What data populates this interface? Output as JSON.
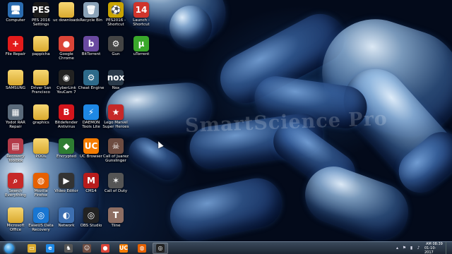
{
  "desktop": {
    "watermark": "SmartScience Pro",
    "icons": [
      {
        "label": "Computer",
        "icon": "computer-icon",
        "glyph": "🖥",
        "color": "#2b6cb0"
      },
      {
        "label": "PES 2016 Settings",
        "icon": "pes-settings-icon",
        "glyph": "PES",
        "color": "#1a1a1a"
      },
      {
        "label": "uc downloads",
        "icon": "folder-icon",
        "glyph": "",
        "color": "#d9a92e"
      },
      {
        "label": "Recycle Bin",
        "icon": "recycle-bin-icon",
        "glyph": "🗑",
        "color": "#8aa2b8"
      },
      {
        "label": "PES2016 - Shortcut",
        "icon": "pes-game-icon",
        "glyph": "⚽",
        "color": "#c9a400"
      },
      {
        "label": "Launch - Shortcut",
        "icon": "launch-icon",
        "glyph": "14",
        "color": "#d0342c"
      },
      {
        "label": "File Repair",
        "icon": "file-repair-icon",
        "glyph": "+",
        "color": "#e31b1b"
      },
      {
        "label": "pappicha",
        "icon": "folder-icon",
        "glyph": "",
        "color": "#d9a92e"
      },
      {
        "label": "Google Chrome",
        "icon": "chrome-icon",
        "glyph": "●",
        "color": "#db4437"
      },
      {
        "label": "BitTorrent",
        "icon": "bittorrent-icon",
        "glyph": "b",
        "color": "#6a4aa0"
      },
      {
        "label": "Gun",
        "icon": "gun-icon",
        "glyph": "⚙",
        "color": "#444"
      },
      {
        "label": "uTorrent",
        "icon": "utorrent-icon",
        "glyph": "µ",
        "color": "#3aa82b"
      },
      {
        "label": "SAMSUNG",
        "icon": "folder-icon",
        "glyph": "",
        "color": "#d9a92e"
      },
      {
        "label": "Driver San Francisco",
        "icon": "folder-icon",
        "glyph": "",
        "color": "#d9a92e"
      },
      {
        "label": "CyberLink YouCam 7",
        "icon": "youcam-icon",
        "glyph": "◉",
        "color": "#222"
      },
      {
        "label": "Cheat Engine",
        "icon": "cheat-engine-icon",
        "glyph": "⚙",
        "color": "#2d6a8a"
      },
      {
        "label": "Nox",
        "icon": "nox-icon",
        "glyph": "nox",
        "color": "#2a3a4a"
      },
      {
        "label": "Yodot RAR Repair",
        "icon": "yodot-icon",
        "glyph": "▦",
        "color": "#5a6a7a"
      },
      {
        "label": "graphics",
        "icon": "folder-icon",
        "glyph": "",
        "color": "#d9a92e"
      },
      {
        "label": "Bitdefender Antivirus",
        "icon": "bitdefender-icon",
        "glyph": "B",
        "color": "#d4151c"
      },
      {
        "label": "DAEMON Tools Lite",
        "icon": "daemon-tools-icon",
        "glyph": "⚡",
        "color": "#1e88e5"
      },
      {
        "label": "Lego Marvel Super Heroes",
        "icon": "lego-marvel-icon",
        "glyph": "★",
        "color": "#c62828"
      },
      {
        "label": "Recovery Toolbox",
        "icon": "recovery-toolbox-icon",
        "glyph": "▤",
        "color": "#b23a48"
      },
      {
        "label": "POOL",
        "icon": "folder-icon",
        "glyph": "",
        "color": "#d9a92e"
      },
      {
        "label": "Encrypted",
        "icon": "encrypted-icon",
        "glyph": "◆",
        "color": "#2e7d32"
      },
      {
        "label": "UC Browser",
        "icon": "uc-browser-icon",
        "glyph": "UC",
        "color": "#f57c00"
      },
      {
        "label": "Call of Juarez Gunslinger",
        "icon": "call-of-juarez-icon",
        "glyph": "☠",
        "color": "#6d4c41"
      },
      {
        "label": "Search Everything",
        "icon": "search-everything-icon",
        "glyph": "⌕",
        "color": "#c62828"
      },
      {
        "label": "Mozilla Firefox",
        "icon": "firefox-icon",
        "glyph": "◍",
        "color": "#e66000"
      },
      {
        "label": "Video Editor",
        "icon": "video-editor-icon",
        "glyph": "▶",
        "color": "#333"
      },
      {
        "label": "CM14",
        "icon": "cm14-icon",
        "glyph": "M",
        "color": "#b71c1c"
      },
      {
        "label": "Call of Duty",
        "icon": "call-of-duty-icon",
        "glyph": "✶",
        "color": "#555"
      },
      {
        "label": "Microsoft Office",
        "icon": "office-folder-icon",
        "glyph": "",
        "color": "#d9a92e"
      },
      {
        "label": "EaseUS Data Recovery",
        "icon": "easeus-icon",
        "glyph": "◎",
        "color": "#1976d2"
      },
      {
        "label": "Network",
        "icon": "network-icon",
        "glyph": "◐",
        "color": "#3d6fb0"
      },
      {
        "label": "OBS Studio",
        "icon": "obs-icon",
        "glyph": "◎",
        "color": "#222"
      },
      {
        "label": "Tiine",
        "icon": "tiine-icon",
        "glyph": "T",
        "color": "#8d6e63"
      }
    ]
  },
  "taskbar": {
    "apps": [
      {
        "name": "explorer",
        "icon": "folder-icon",
        "glyph": "▭",
        "color": "#d9a92e",
        "active": false
      },
      {
        "name": "ie",
        "icon": "internet-explorer-icon",
        "glyph": "e",
        "color": "#1e88e5",
        "active": false
      },
      {
        "name": "game",
        "icon": "game-icon",
        "glyph": "♞",
        "color": "#555",
        "active": false
      },
      {
        "name": "hero",
        "icon": "character-icon",
        "glyph": "☺",
        "color": "#6d4c41",
        "active": false
      },
      {
        "name": "chrome",
        "icon": "chrome-icon",
        "glyph": "●",
        "color": "#db4437",
        "active": false
      },
      {
        "name": "uc",
        "icon": "uc-browser-icon",
        "glyph": "UC",
        "color": "#f57c00",
        "active": false
      },
      {
        "name": "firefox",
        "icon": "firefox-icon",
        "glyph": "◍",
        "color": "#e66000",
        "active": false
      },
      {
        "name": "obs",
        "icon": "obs-icon",
        "glyph": "◎",
        "color": "#222",
        "active": true
      }
    ],
    "clock_time": "AM 08:39",
    "clock_date": "01-10-2017"
  }
}
